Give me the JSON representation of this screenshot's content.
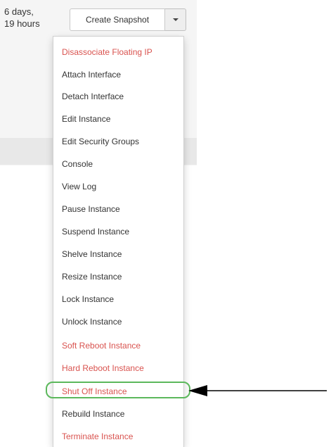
{
  "uptime": {
    "line1": "6 days,",
    "line2": "19 hours"
  },
  "actions": {
    "snapshot_label": "Create Snapshot",
    "caret_icon": "caret-down-icon"
  },
  "menu": {
    "items": [
      {
        "label": "Disassociate Floating IP",
        "danger": true
      },
      {
        "label": "Attach Interface",
        "danger": false
      },
      {
        "label": "Detach Interface",
        "danger": false
      },
      {
        "label": "Edit Instance",
        "danger": false
      },
      {
        "label": "Edit Security Groups",
        "danger": false
      },
      {
        "label": "Console",
        "danger": false
      },
      {
        "label": "View Log",
        "danger": false
      },
      {
        "label": "Pause Instance",
        "danger": false
      },
      {
        "label": "Suspend Instance",
        "danger": false
      },
      {
        "label": "Shelve Instance",
        "danger": false
      },
      {
        "label": "Resize Instance",
        "danger": false
      },
      {
        "label": "Lock Instance",
        "danger": false
      },
      {
        "label": "Unlock Instance",
        "danger": false
      },
      {
        "label": "Soft Reboot Instance",
        "danger": true
      },
      {
        "label": "Hard Reboot Instance",
        "danger": true
      },
      {
        "label": "Shut Off Instance",
        "danger": true
      },
      {
        "label": "Rebuild Instance",
        "danger": false
      },
      {
        "label": "Terminate Instance",
        "danger": true
      }
    ]
  },
  "annotation": {
    "highlighted_item": "Shut Off Instance",
    "highlight_color": "#5cb85c",
    "arrow_color": "#000000"
  },
  "colors": {
    "danger": "#d9534f",
    "text": "#333333"
  }
}
